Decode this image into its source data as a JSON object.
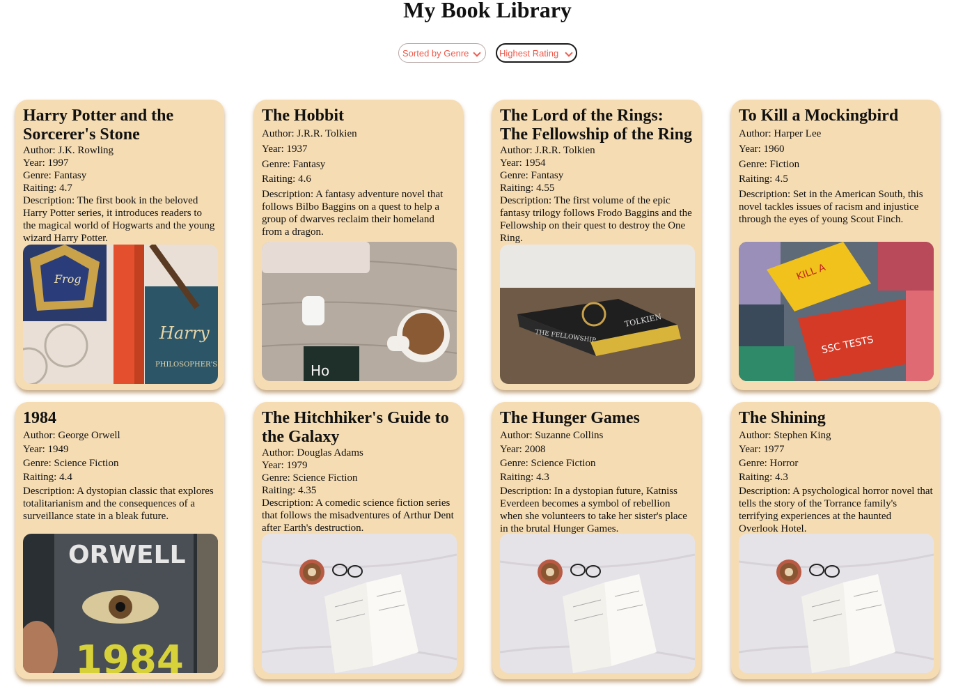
{
  "page": {
    "title": "My Book Library"
  },
  "filters": {
    "sort_label": "Sorted by Genre",
    "rating_label": "Highest Rating"
  },
  "books": [
    {
      "title": "Harry Potter and the Sorcerer's Stone",
      "author": "Author: J.K. Rowling",
      "year": "Year: 1997",
      "genre": "Genre: Fantasy",
      "rating": "Raiting: 4.7",
      "description": "Description: The first book in the beloved Harry Potter series, it introduces readers to the magical world of Hogwarts and the young wizard Harry Potter.",
      "image_name": "harry-potter-photo"
    },
    {
      "title": "The Hobbit",
      "author": "Author: J.R.R. Tolkien",
      "year": "Year: 1937",
      "genre": "Genre: Fantasy",
      "rating": "Raiting: 4.6",
      "description": "Description: A fantasy adventure novel that follows Bilbo Baggins on a quest to help a group of dwarves reclaim their homeland from a dragon.",
      "image_name": "coffee-desk-photo"
    },
    {
      "title": "The Lord of the Rings: The Fellowship of the Ring",
      "author": "Author: J.R.R. Tolkien",
      "year": "Year: 1954",
      "genre": "Genre: Fantasy",
      "rating": "Raiting: 4.55",
      "description": "Description: The first volume of the epic fantasy trilogy follows Frodo Baggins and the Fellowship on their quest to destroy the One Ring.",
      "image_name": "fellowship-book-photo"
    },
    {
      "title": "To Kill a Mockingbird",
      "author": "Author: Harper Lee",
      "year": "Year: 1960",
      "genre": "Genre: Fiction",
      "rating": "Raiting: 4.5",
      "description": "Description: Set in the American South, this novel tackles issues of racism and injustice through the eyes of young Scout Finch.",
      "image_name": "book-pile-photo"
    },
    {
      "title": "1984",
      "author": "Author: George Orwell",
      "year": "Year: 1949",
      "genre": "Genre: Science Fiction",
      "rating": "Raiting: 4.4",
      "description": "Description: A dystopian classic that explores totalitarianism and the consequences of a surveillance state in a bleak future.",
      "image_name": "orwell-1984-photo"
    },
    {
      "title": "The Hitchhiker's Guide to the Galaxy",
      "author": "Author: Douglas Adams",
      "year": "Year: 1979",
      "genre": "Genre: Science Fiction",
      "rating": "Raiting: 4.35",
      "description": "Description: A comedic science fiction series that follows the misadventures of Arthur Dent after Earth's destruction.",
      "image_name": "open-book-coffee-photo"
    },
    {
      "title": "The Hunger Games",
      "author": "Author: Suzanne Collins",
      "year": "Year: 2008",
      "genre": "Genre: Science Fiction",
      "rating": "Raiting: 4.3",
      "description": "Description: In a dystopian future, Katniss Everdeen becomes a symbol of rebellion when she volunteers to take her sister's place in the brutal Hunger Games.",
      "image_name": "open-book-coffee-photo"
    },
    {
      "title": "The Shining",
      "author": "Author: Stephen King",
      "year": "Year: 1977",
      "genre": "Genre: Horror",
      "rating": "Raiting: 4.3",
      "description": "Description: A psychological horror novel that tells the story of the Torrance family's terrifying experiences at the haunted Overlook Hotel.",
      "image_name": "open-book-coffee-photo"
    }
  ]
}
